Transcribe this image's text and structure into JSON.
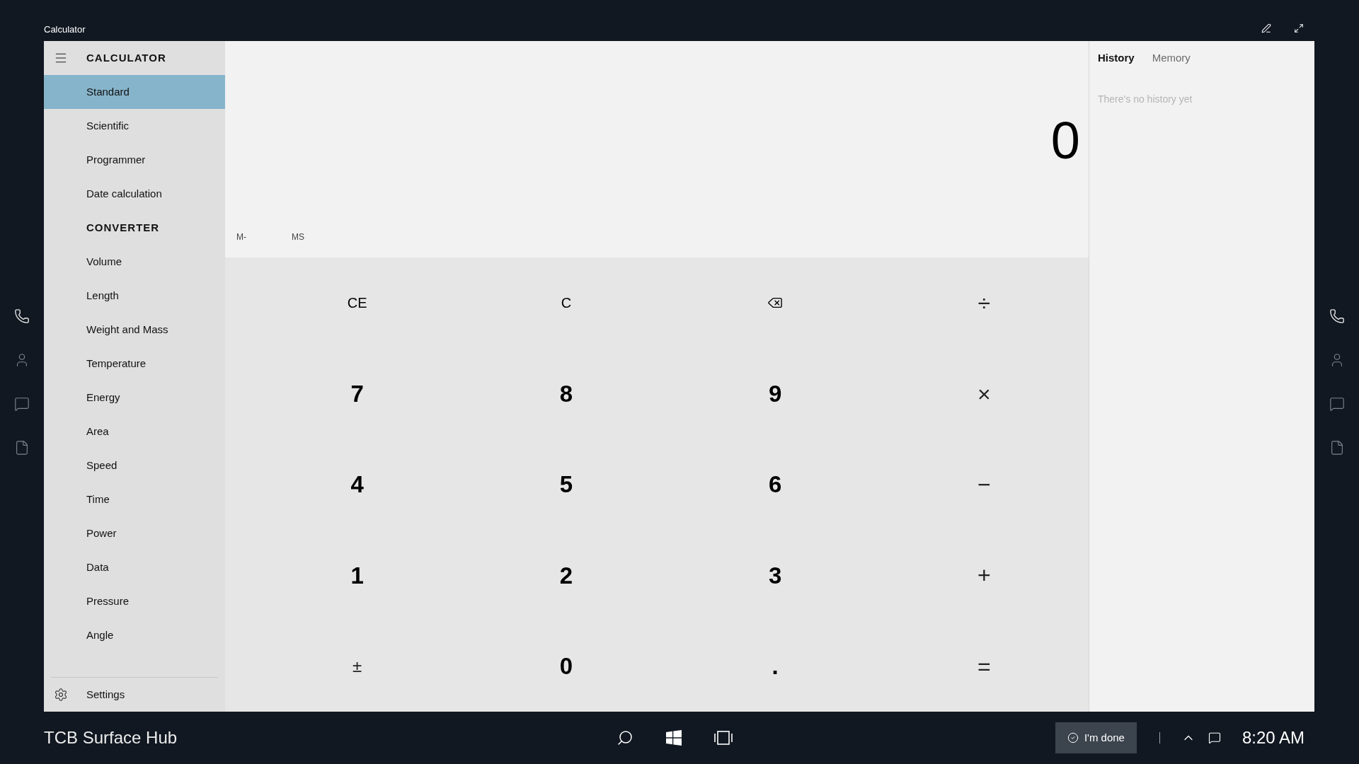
{
  "window": {
    "title": "Calculator"
  },
  "nav": {
    "title": "CALCULATOR",
    "modes": [
      {
        "label": "Standard",
        "selected": true
      },
      {
        "label": "Scientific",
        "selected": false
      },
      {
        "label": "Programmer",
        "selected": false
      },
      {
        "label": "Date calculation",
        "selected": false
      }
    ],
    "converter_title": "CONVERTER",
    "converters": [
      {
        "label": "Volume",
        "selected": false
      },
      {
        "label": "Length",
        "selected": false
      },
      {
        "label": "Weight and Mass",
        "selected": false
      },
      {
        "label": "Temperature",
        "selected": false
      },
      {
        "label": "Energy",
        "selected": false
      },
      {
        "label": "Area",
        "selected": false
      },
      {
        "label": "Speed",
        "selected": false
      },
      {
        "label": "Time",
        "selected": false
      },
      {
        "label": "Power",
        "selected": false
      },
      {
        "label": "Data",
        "selected": false
      },
      {
        "label": "Pressure",
        "selected": false
      },
      {
        "label": "Angle",
        "selected": false
      }
    ],
    "settings": "Settings"
  },
  "display": {
    "value": "0",
    "memory_buttons": [
      "M-",
      "MS"
    ]
  },
  "keypad": {
    "rows": [
      [
        {
          "kind": "clear",
          "label": "CE"
        },
        {
          "kind": "clear",
          "label": "C"
        },
        {
          "kind": "backspace"
        },
        {
          "kind": "operator",
          "label": "÷"
        }
      ],
      [
        {
          "kind": "digit",
          "label": "7"
        },
        {
          "kind": "digit",
          "label": "8"
        },
        {
          "kind": "digit",
          "label": "9"
        },
        {
          "kind": "operator",
          "label": "×"
        }
      ],
      [
        {
          "kind": "digit",
          "label": "4"
        },
        {
          "kind": "digit",
          "label": "5"
        },
        {
          "kind": "digit",
          "label": "6"
        },
        {
          "kind": "operator",
          "label": "−"
        }
      ],
      [
        {
          "kind": "digit",
          "label": "1"
        },
        {
          "kind": "digit",
          "label": "2"
        },
        {
          "kind": "digit",
          "label": "3"
        },
        {
          "kind": "operator",
          "label": "+"
        }
      ],
      [
        {
          "kind": "sign",
          "label": "±"
        },
        {
          "kind": "digit",
          "label": "0"
        },
        {
          "kind": "decimal",
          "label": "."
        },
        {
          "kind": "operator",
          "label": "="
        }
      ]
    ]
  },
  "history_panel": {
    "tabs": [
      {
        "label": "History",
        "selected": true
      },
      {
        "label": "Memory",
        "selected": false
      }
    ],
    "empty_message": "There's no history yet"
  },
  "taskbar": {
    "device_name": "TCB Surface Hub",
    "done_button": "I'm done",
    "time": "8:20 AM"
  }
}
